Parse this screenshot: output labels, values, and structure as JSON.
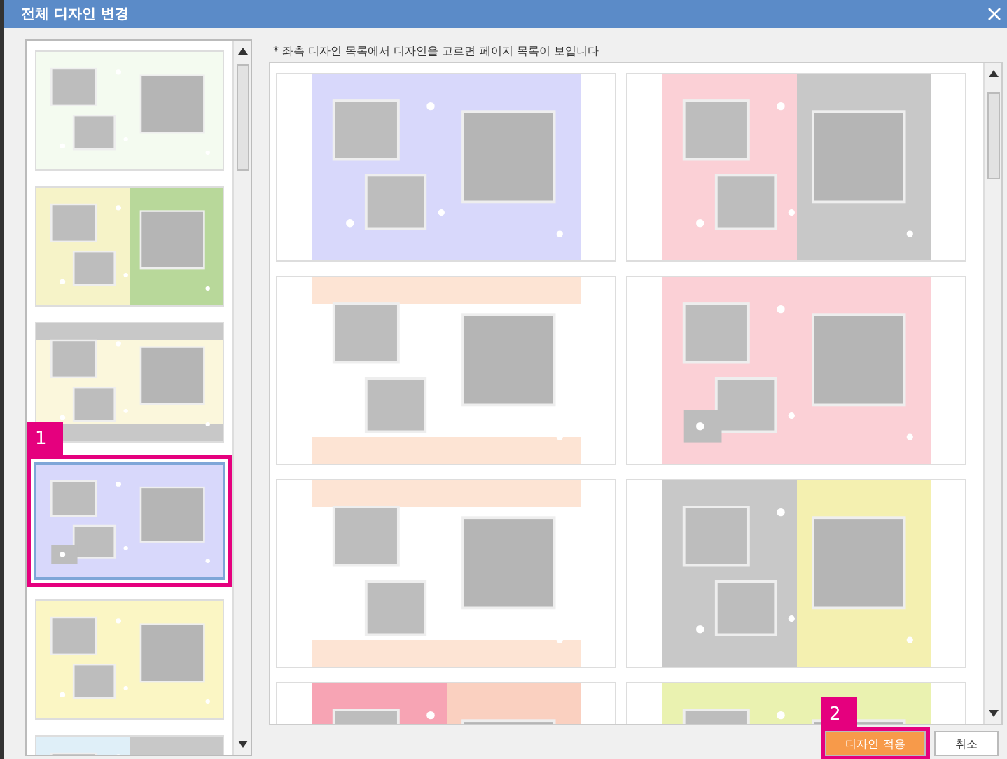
{
  "window": {
    "title": "전체 디자인 변경"
  },
  "hint": "* 좌측 디자인 목록에서 디자인을 고르면 페이지 목록이 보입니다",
  "designs": [
    {
      "selected": false
    },
    {
      "selected": false
    },
    {
      "selected": false
    },
    {
      "selected": true,
      "badge": "1"
    },
    {
      "selected": false
    },
    {
      "selected": false
    }
  ],
  "buttons": [
    {
      "label": "디자인 적용",
      "kind": "primary",
      "badge": "2"
    },
    {
      "label": "취소",
      "kind": "secondary"
    }
  ]
}
